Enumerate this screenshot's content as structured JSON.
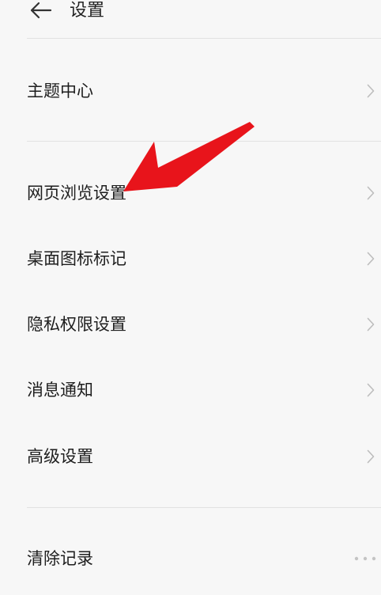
{
  "header": {
    "title": "设置"
  },
  "menu": {
    "items": [
      {
        "label": "主题中心"
      },
      {
        "label": "网页浏览设置"
      },
      {
        "label": "桌面图标标记"
      },
      {
        "label": "隐私权限设置"
      },
      {
        "label": "消息通知"
      },
      {
        "label": "高级设置"
      },
      {
        "label": "清除记录"
      }
    ]
  },
  "annotation": {
    "arrow_color": "#e8141b"
  },
  "icons": [
    "back-arrow-icon",
    "chevron-right-icon",
    "more-icon",
    "pointer-arrow-icon"
  ]
}
